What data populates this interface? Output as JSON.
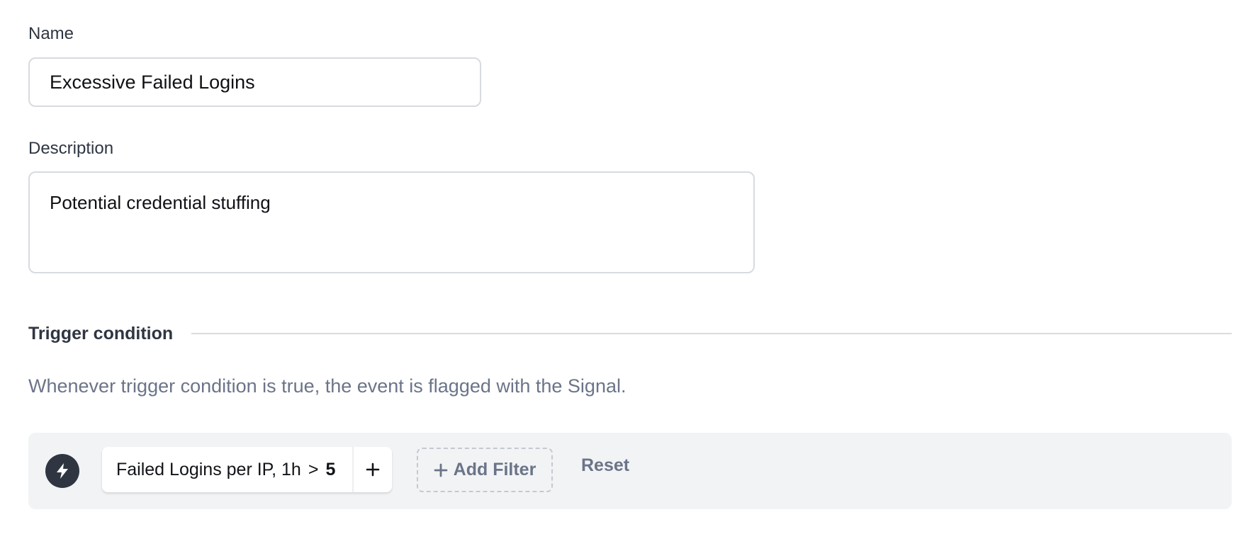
{
  "form": {
    "name_label": "Name",
    "name_value": "Excessive Failed Logins",
    "description_label": "Description",
    "description_value": "Potential credential stuffing"
  },
  "trigger": {
    "section_title": "Trigger condition",
    "helper_text": "Whenever trigger condition is true, the event is flagged with the Signal.",
    "icon": "lightning-bolt-icon",
    "condition": {
      "metric": "Failed Logins per IP, 1h",
      "operator": ">",
      "value": "5"
    },
    "add_filter_label": "Add Filter",
    "reset_label": "Reset"
  },
  "colors": {
    "text_primary": "#2f3642",
    "text_muted": "#6b7488",
    "panel_bg": "#f2f3f5",
    "border": "#d7dbe0"
  }
}
